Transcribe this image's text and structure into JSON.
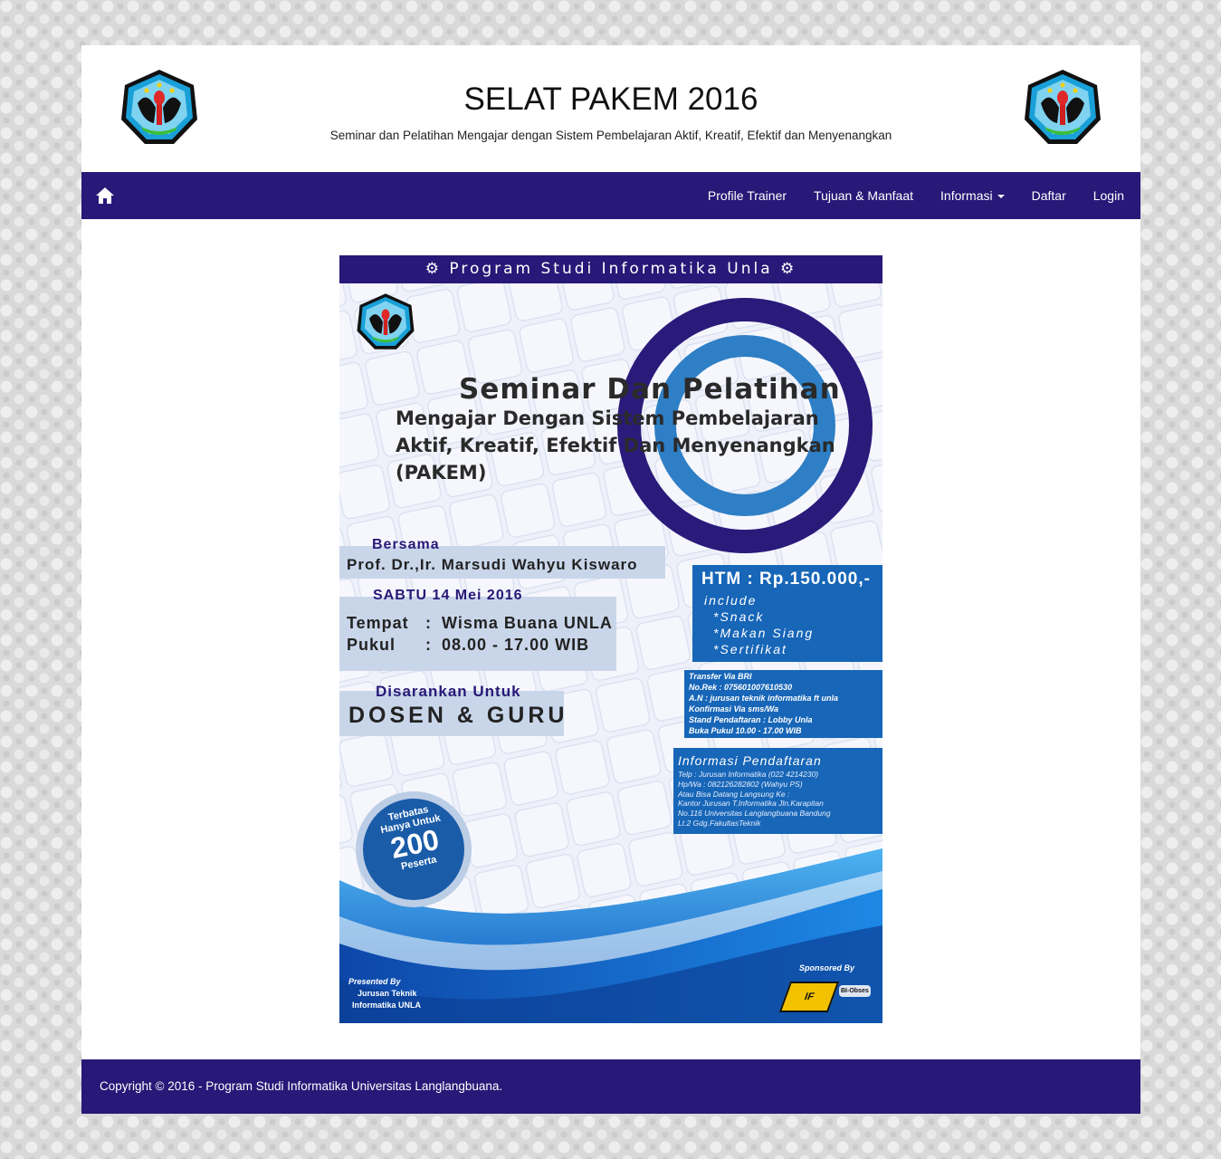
{
  "header": {
    "title": "SELAT PAKEM 2016",
    "subtitle": "Seminar dan Pelatihan Mengajar dengan Sistem Pembelajaran Aktif, Kreatif, Efektif dan Menyenangkan"
  },
  "nav": {
    "home_icon": "home-icon",
    "items": [
      {
        "label": "Profile Trainer"
      },
      {
        "label": "Tujuan & Manfaat"
      },
      {
        "label": "Informasi",
        "dropdown": true
      },
      {
        "label": "Daftar"
      },
      {
        "label": "Login"
      }
    ]
  },
  "poster": {
    "banner": "Program Studi Informatika Unla",
    "title": "Seminar Dan Pelatihan",
    "subtitle_lines": [
      "Mengajar Dengan Sistem Pembelajaran",
      "Aktif, Kreatif, Efektif Dan Menyenangkan",
      "(PAKEM)"
    ],
    "bersama_label": "Bersama",
    "speaker": "Prof. Dr.,Ir. Marsudi Wahyu Kiswaro",
    "date": "SABTU 14 Mei 2016",
    "tempat_label": "Tempat",
    "tempat_sep": ":",
    "tempat_value": "Wisma Buana UNLA",
    "pukul_label": "Pukul",
    "pukul_sep": ":",
    "pukul_value": "08.00 - 17.00 WIB",
    "disarankan_label": "Disarankan Untuk",
    "audience": "DOSEN & GURU",
    "htm_title": "HTM : Rp.150.000,-",
    "htm_include": "include",
    "htm_items": [
      "*Snack",
      "*Makan Siang",
      "*Sertifikat"
    ],
    "transfer_lines": [
      "Transfer Via BRI",
      "No.Rek : 075601007610530",
      "A.N : jurusan teknik informatika ft unla",
      "Konfirmasi Via sms/Wa",
      "Stand Pendaftaran : Lobby Unla",
      "Buka Pukul 10.00 - 17.00 WIB"
    ],
    "info_title": "Informasi Pendaftaran",
    "info_lines": [
      "Telp : Jurusan Informatika (022 4214230)",
      "Hp/Wa : 082126282802 (Wahyu PS)",
      "Atau Bisa Datang Langsung Ke :",
      "Kantor Jurusan T.Informatika Jln.Karapitan",
      "No.116 Universitas Langlangbuana Bandung",
      "Lt.2 Gdg.FakultasTeknik"
    ],
    "badge_line1": "Terbatas",
    "badge_line2": "Hanya Untuk",
    "badge_number": "200",
    "badge_line3": "Peserta",
    "presented_label": "Presented By",
    "presented_line1": "Jurusan Teknik",
    "presented_line2": "Informatika UNLA",
    "sponsored_label": "Sponsored By",
    "sponsor1": "IF",
    "sponsor2": "BI-Obses"
  },
  "footer": {
    "text": "Copyright © 2016 - Program Studi Informatika Universitas Langlangbuana."
  }
}
